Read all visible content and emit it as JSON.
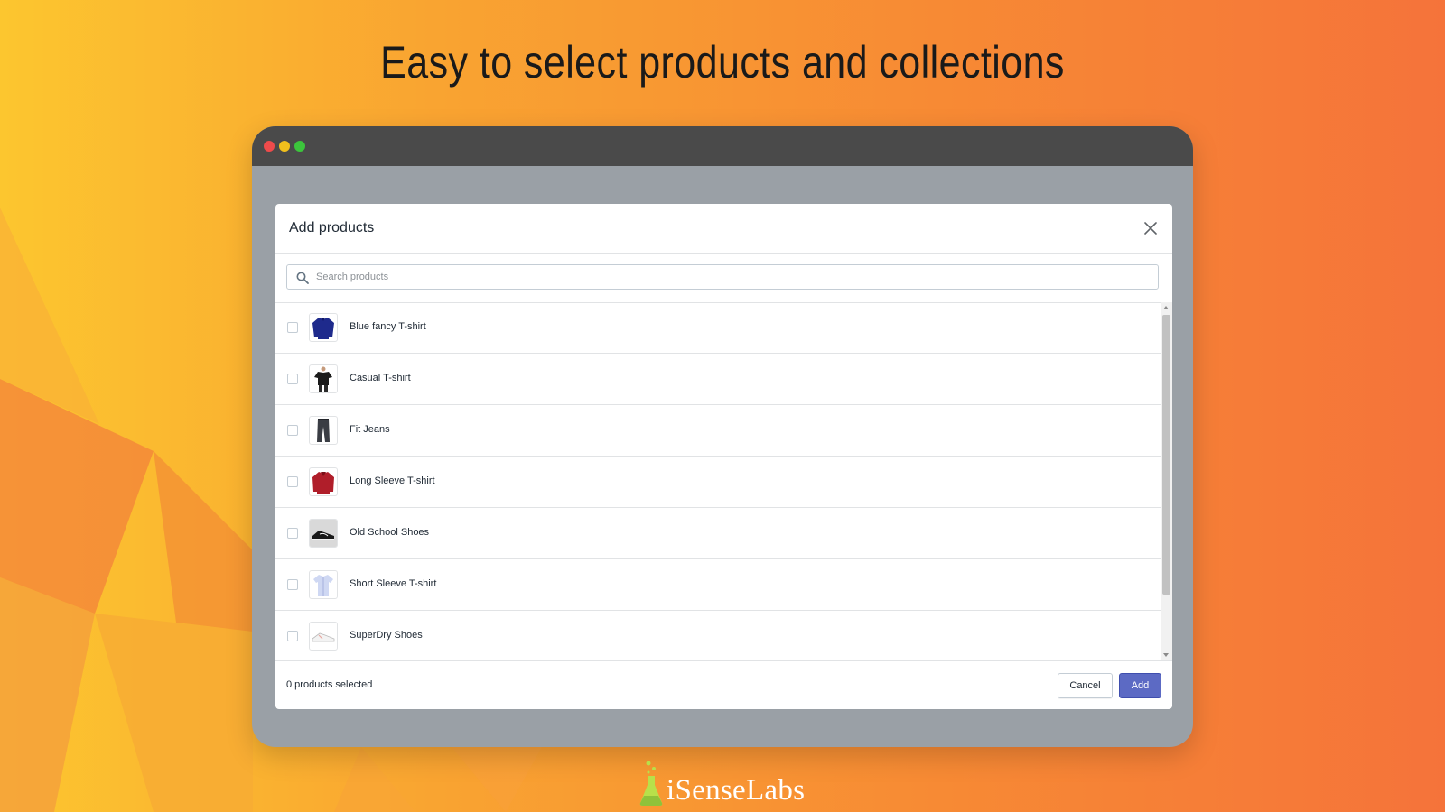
{
  "headline": "Easy to select products and collections",
  "modal": {
    "title": "Add products",
    "search_placeholder": "Search products",
    "products": [
      {
        "name": "Blue fancy T-shirt"
      },
      {
        "name": "Casual T-shirt"
      },
      {
        "name": "Fit Jeans"
      },
      {
        "name": "Long Sleeve T-shirt"
      },
      {
        "name": "Old School Shoes"
      },
      {
        "name": "Short Sleeve T-shirt"
      },
      {
        "name": "SuperDry Shoes"
      }
    ],
    "selected_count": "0 products selected",
    "cancel_label": "Cancel",
    "add_label": "Add"
  },
  "brand": {
    "name": "iSenseLabs"
  },
  "colors": {
    "primary_button": "#5c6ac4",
    "window_dot_red": "#ee4b4b",
    "window_dot_yellow": "#f2c01c",
    "window_dot_green": "#3cc53c"
  }
}
